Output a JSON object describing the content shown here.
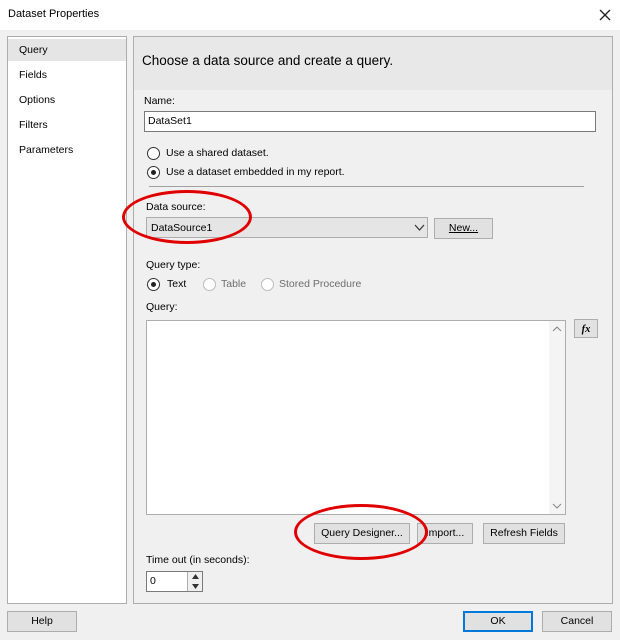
{
  "window": {
    "title": "Dataset Properties"
  },
  "sidebar": {
    "items": [
      {
        "label": "Query",
        "selected": true
      },
      {
        "label": "Fields"
      },
      {
        "label": "Options"
      },
      {
        "label": "Filters"
      },
      {
        "label": "Parameters"
      }
    ]
  },
  "main": {
    "heading": "Choose a data source and create a query.",
    "name_label": "Name:",
    "name_value": "DataSet1",
    "radio_shared": "Use a shared dataset.",
    "radio_embedded": "Use a dataset embedded in my report.",
    "embedded_selected": true,
    "data_source_label": "Data source:",
    "data_source_value": "DataSource1",
    "new_button": "New...",
    "query_type_label": "Query type:",
    "query_types": [
      {
        "label": "Text",
        "selected": true
      },
      {
        "label": "Table",
        "disabled": true
      },
      {
        "label": "Stored Procedure",
        "disabled": true
      }
    ],
    "query_label": "Query:",
    "query_value": "",
    "fx_button": "fx",
    "query_designer_button": "Query Designer...",
    "import_button": "Import...",
    "refresh_fields_button": "Refresh Fields",
    "timeout_label": "Time out (in seconds):",
    "timeout_value": "0"
  },
  "footer": {
    "help": "Help",
    "ok": "OK",
    "cancel": "Cancel"
  },
  "colors": {
    "highlight_ellipse": "#e00000",
    "selected_nav": "#e5e5e5",
    "header_band": "#e8e8e8"
  },
  "icons": [
    "close-icon",
    "dropdown-chevron-icon",
    "function-icon",
    "scroll-up-icon",
    "scroll-down-icon",
    "spin-up-icon",
    "spin-down-icon"
  ]
}
